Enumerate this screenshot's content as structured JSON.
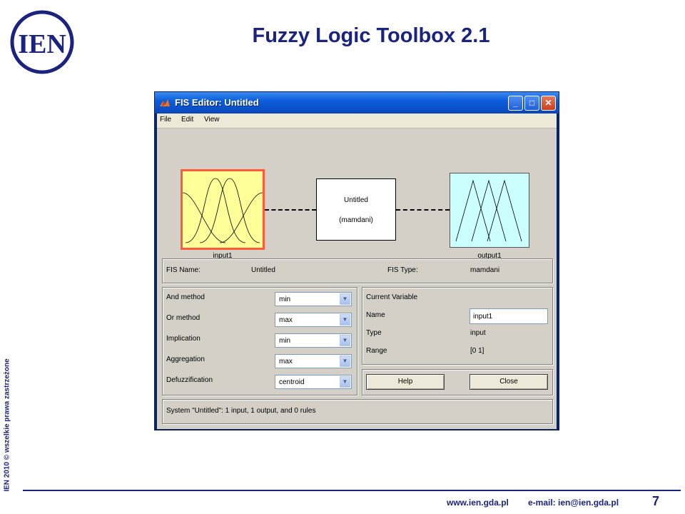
{
  "slide": {
    "logo_text": "IEN",
    "title": "Fuzzy Logic Toolbox 2.1",
    "side_note": "IEN 2010 © wszelkie prawa zastrzeżone",
    "footer_web": "www.ien.gda.pl",
    "footer_email": "e-mail: ien@ien.gda.pl",
    "page_number": "7",
    "brand_color": "#1a237e"
  },
  "window": {
    "title": "FIS Editor: Untitled",
    "controls": {
      "minimize": "_",
      "maximize": "□",
      "close": "✕"
    },
    "app_icon": "matlab-icon"
  },
  "menu": [
    "File",
    "Edit",
    "View"
  ],
  "diagram": {
    "input_label": "input1",
    "system_name": "Untitled",
    "system_type": "(mamdani)",
    "output_label": "output1",
    "input_color": "#ffff99",
    "output_color": "#ccffff",
    "selected_outline": "#ff5a3a"
  },
  "fis_info": {
    "name_label": "FIS Name:",
    "name_value": "Untitled",
    "type_label": "FIS Type:",
    "type_value": "mamdani"
  },
  "methods": [
    {
      "label": "And method",
      "value": "min"
    },
    {
      "label": "Or method",
      "value": "max"
    },
    {
      "label": "Implication",
      "value": "min"
    },
    {
      "label": "Aggregation",
      "value": "max"
    },
    {
      "label": "Defuzzification",
      "value": "centroid"
    }
  ],
  "current_variable": {
    "heading": "Current Variable",
    "name_label": "Name",
    "name_value": "input1",
    "type_label": "Type",
    "type_value": "input",
    "range_label": "Range",
    "range_value": "[0 1]"
  },
  "buttons": {
    "help": "Help",
    "close": "Close"
  },
  "status": "System \"Untitled\": 1 input, 1 output, and 0 rules"
}
